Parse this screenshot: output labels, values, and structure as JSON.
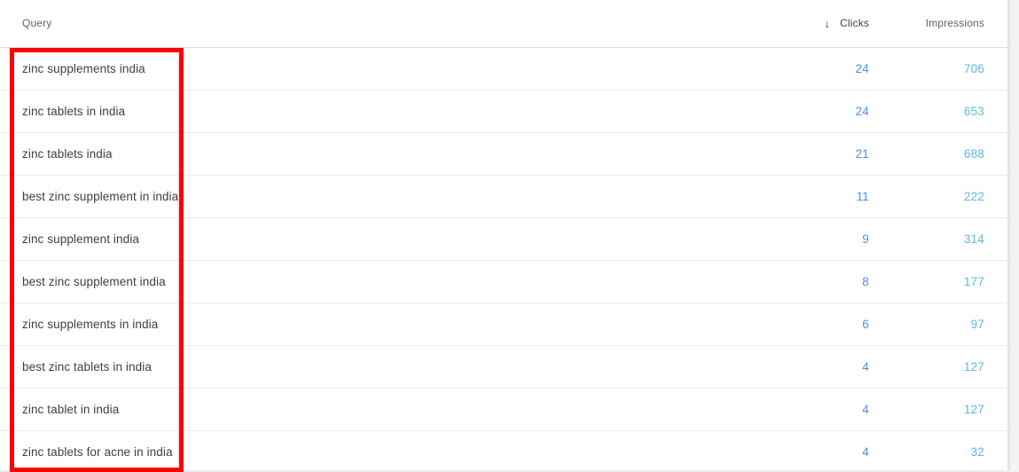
{
  "table": {
    "columns": [
      {
        "key": "query",
        "label": "Query",
        "align": "left",
        "sorted": false
      },
      {
        "key": "clicks",
        "label": "Clicks",
        "align": "right",
        "sorted": true,
        "sort_direction": "desc",
        "sort_icon": "arrow-down-icon",
        "sort_glyph": "↓"
      },
      {
        "key": "impressions",
        "label": "Impressions",
        "align": "right",
        "sorted": false
      }
    ],
    "rows": [
      {
        "query": "zinc supplements india",
        "clicks": "24",
        "impressions": "706"
      },
      {
        "query": "zinc tablets in india",
        "clicks": "24",
        "impressions": "653"
      },
      {
        "query": "zinc tablets india",
        "clicks": "21",
        "impressions": "688"
      },
      {
        "query": "best zinc supplement in india",
        "clicks": "11",
        "impressions": "222"
      },
      {
        "query": "zinc supplement india",
        "clicks": "9",
        "impressions": "314"
      },
      {
        "query": "best zinc supplement india",
        "clicks": "8",
        "impressions": "177"
      },
      {
        "query": "zinc supplements in india",
        "clicks": "6",
        "impressions": "97"
      },
      {
        "query": "best zinc tablets in india",
        "clicks": "4",
        "impressions": "127"
      },
      {
        "query": "zinc tablet in india",
        "clicks": "4",
        "impressions": "127"
      },
      {
        "query": "zinc tablets for acne in india",
        "clicks": "4",
        "impressions": "32"
      }
    ]
  },
  "annotation": {
    "shape": "rectangle",
    "color": "#fa0000",
    "target_column": "Query"
  },
  "colors": {
    "clicks_value": "#4a90e2",
    "impressions_value": "#5bb8dd",
    "query_text": "#3c4043",
    "header_muted": "#5f6368",
    "header_active": "#3c4043",
    "row_divider": "#e8eaed",
    "page_background": "#f1f3f4",
    "card_background": "#ffffff",
    "annotation": "#fa0000"
  }
}
